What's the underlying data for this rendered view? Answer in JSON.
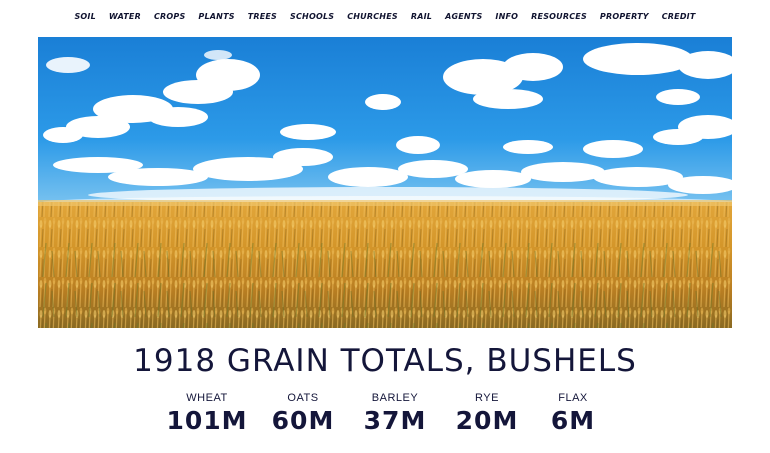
{
  "nav": {
    "items": [
      {
        "label": "SOIL"
      },
      {
        "label": "WATER"
      },
      {
        "label": "CROPS"
      },
      {
        "label": "PLANTS"
      },
      {
        "label": "TREES"
      },
      {
        "label": "SCHOOLS"
      },
      {
        "label": "CHURCHES"
      },
      {
        "label": "RAIL"
      },
      {
        "label": "AGENTS"
      },
      {
        "label": "INFO"
      },
      {
        "label": "RESOURCES"
      },
      {
        "label": "PROPERTY"
      },
      {
        "label": "CREDIT"
      }
    ]
  },
  "hero": {
    "sky_color": "#1f8ee0",
    "field_color": "#d99a2b"
  },
  "title": "1918 GRAIN TOTALS, BUSHELS",
  "stats": [
    {
      "label": "WHEAT",
      "value": "101M"
    },
    {
      "label": "OATS",
      "value": "60M"
    },
    {
      "label": "BARLEY",
      "value": "37M"
    },
    {
      "label": "RYE",
      "value": "20M"
    },
    {
      "label": "FLAX",
      "value": "6M"
    }
  ]
}
